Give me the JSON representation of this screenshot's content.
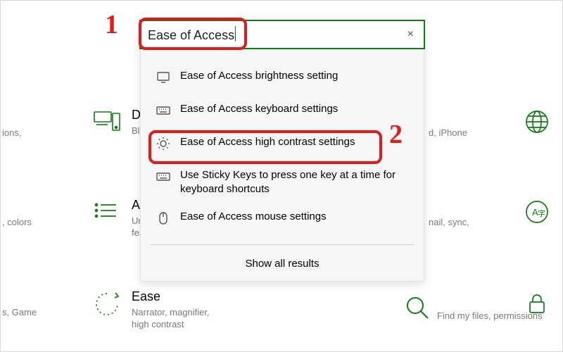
{
  "accent": "#107c10",
  "annotations": {
    "n1": "1",
    "n2": "2"
  },
  "search": {
    "value": "Ease of Access",
    "clear_glyph": "×",
    "results": [
      {
        "icon": "monitor-icon",
        "label": "Ease of Access brightness setting"
      },
      {
        "icon": "keyboard-icon",
        "label": "Ease of Access keyboard settings"
      },
      {
        "icon": "sun-icon",
        "label": "Ease of Access high contrast settings"
      },
      {
        "icon": "keyboard-icon",
        "label": "Use Sticky Keys to press one key at a time for keyboard shortcuts"
      },
      {
        "icon": "mouse-icon",
        "label": "Ease of Access mouse settings"
      }
    ],
    "show_all": "Show all results"
  },
  "bg_categories": {
    "devices": {
      "title": "Devices",
      "sub_left": "ions,",
      "sub_right": "Bluetooth, printers, mouse"
    },
    "apps": {
      "title": "Apps",
      "sub_left": ", colors",
      "sub_right": "Uninstall, defaults, optional features"
    },
    "ease": {
      "title": "Ease of Access",
      "sub_left": "s, Game",
      "sub_right": "Narrator, magnifier, high contrast"
    },
    "phone": {
      "sub": "d, iPhone"
    },
    "accounts": {
      "sub": "nail, sync,"
    },
    "search": {
      "sub": "Find my files, permissions"
    }
  }
}
